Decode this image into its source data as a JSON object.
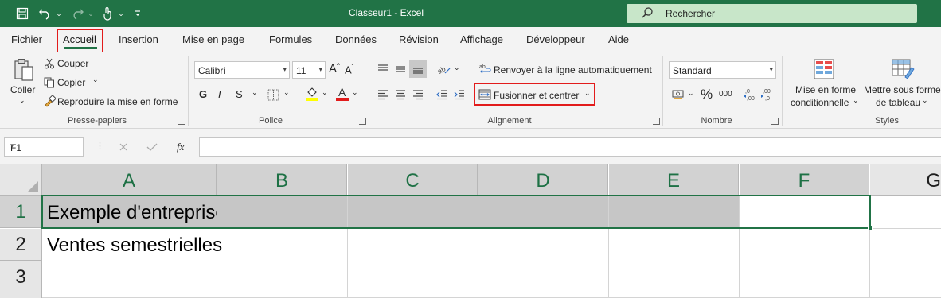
{
  "window": {
    "title": "Classeur1  -  Excel",
    "search_placeholder": "Rechercher"
  },
  "tabs": [
    "Fichier",
    "Accueil",
    "Insertion",
    "Mise en page",
    "Formules",
    "Données",
    "Révision",
    "Affichage",
    "Développeur",
    "Aide"
  ],
  "active_tab": "Accueil",
  "ribbon": {
    "clipboard": {
      "paste": "Coller",
      "cut": "Couper",
      "copy": "Copier",
      "format_painter": "Reproduire la mise en forme",
      "label": "Presse-papiers"
    },
    "font": {
      "font_name": "Calibri",
      "font_size": "11",
      "bold": "G",
      "italic": "I",
      "underline": "S",
      "label": "Police"
    },
    "alignment": {
      "wrap_text": "Renvoyer à la ligne automatiquement",
      "merge_center": "Fusionner et centrer",
      "label": "Alignement"
    },
    "number": {
      "format": "Standard",
      "percent": "%",
      "thousands": "000",
      "label": "Nombre"
    },
    "styles": {
      "conditional_formatting_line1": "Mise en forme",
      "conditional_formatting_line2": "conditionnelle",
      "format_as_table_line1": "Mettre sous forme",
      "format_as_table_line2": "de tableau",
      "label": "Styles"
    }
  },
  "formula_bar": {
    "name_box": "F1",
    "fx": "fx",
    "content": ""
  },
  "grid": {
    "columns": [
      "A",
      "B",
      "C",
      "D",
      "E",
      "F",
      "G"
    ],
    "rows": [
      "1",
      "2",
      "3"
    ],
    "cells": {
      "A1": "Exemple d'entreprise",
      "A2": "Ventes semestrielles"
    }
  },
  "colors": {
    "excel_green": "#217346",
    "highlight_red": "#e21b1b",
    "selection_gray": "#c6c6c6"
  }
}
